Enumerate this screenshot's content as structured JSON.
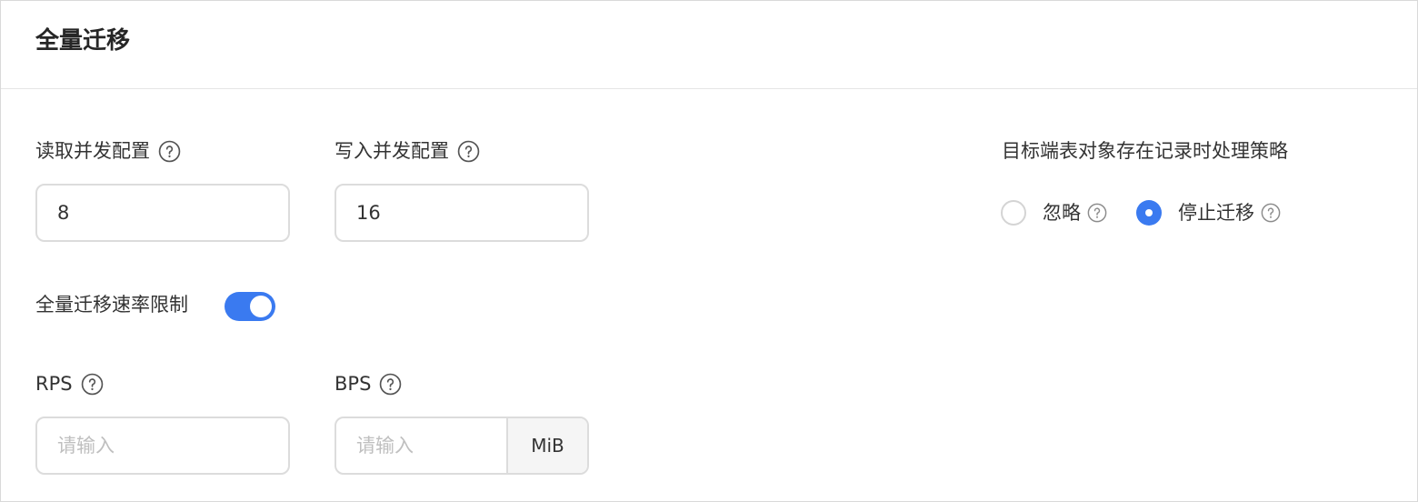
{
  "panel": {
    "title": "全量迁移"
  },
  "read_concurrency": {
    "label": "读取并发配置",
    "value": "8",
    "help_icon": "question-circle-icon"
  },
  "write_concurrency": {
    "label": "写入并发配置",
    "value": "16",
    "help_icon": "question-circle-icon"
  },
  "rate_limit": {
    "label": "全量迁移速率限制",
    "enabled": true
  },
  "rps": {
    "label": "RPS",
    "placeholder": "请输入",
    "value": "",
    "help_icon": "question-circle-icon"
  },
  "bps": {
    "label": "BPS",
    "placeholder": "请输入",
    "value": "",
    "unit": "MiB",
    "help_icon": "question-circle-icon"
  },
  "conflict_strategy": {
    "label": "目标端表对象存在记录时处理策略",
    "options": [
      {
        "label": "忽略",
        "checked": false
      },
      {
        "label": "停止迁移",
        "checked": true
      }
    ],
    "selected": "停止迁移"
  },
  "colors": {
    "accent": "#3a7af0",
    "border": "#dcdcdc",
    "text": "#333333",
    "placeholder": "#bfbfbf"
  }
}
